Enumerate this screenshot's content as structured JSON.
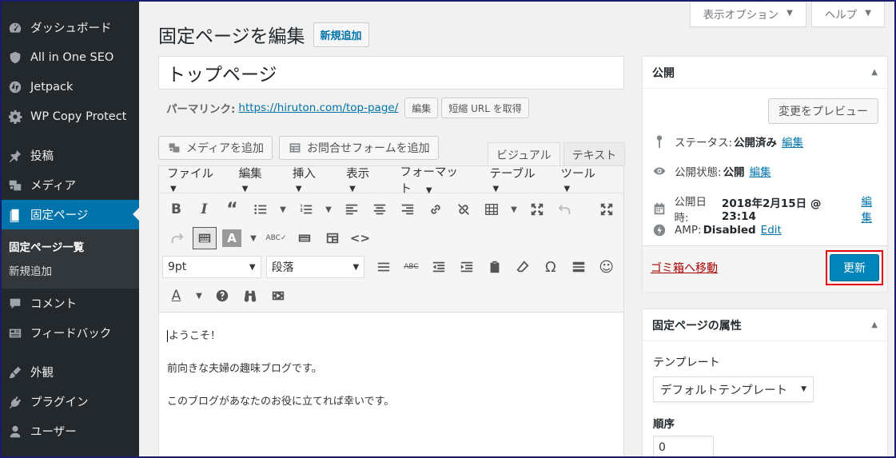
{
  "sidebar": {
    "items": [
      {
        "label": "ダッシュボード",
        "icon": "dashboard-icon"
      },
      {
        "label": "All in One SEO",
        "icon": "shield-icon"
      },
      {
        "label": "Jetpack",
        "icon": "jetpack-icon"
      },
      {
        "label": "WP Copy Protect",
        "icon": "gear-icon"
      },
      {
        "label": "投稿",
        "icon": "pin-icon"
      },
      {
        "label": "メディア",
        "icon": "media-icon"
      },
      {
        "label": "固定ページ",
        "icon": "page-icon"
      },
      {
        "label": "コメント",
        "icon": "comment-icon"
      },
      {
        "label": "フィードバック",
        "icon": "feedback-icon"
      },
      {
        "label": "外観",
        "icon": "appearance-icon"
      },
      {
        "label": "プラグイン",
        "icon": "plugin-icon"
      },
      {
        "label": "ユーザー",
        "icon": "user-icon"
      }
    ],
    "submenu": [
      {
        "label": "固定ページ一覧"
      },
      {
        "label": "新規追加"
      }
    ]
  },
  "header": {
    "screen_options": "表示オプション",
    "help": "ヘルプ",
    "title": "固定ページを編集",
    "add_new": "新規追加"
  },
  "post": {
    "title": "トップページ",
    "permalink_label": "パーマリンク:",
    "permalink_url": "https://hiruton.com/top-page/",
    "edit_btn": "編集",
    "shortlink_btn": "短縮 URL を取得"
  },
  "editor": {
    "add_media": "メディアを追加",
    "add_form": "お問合せフォームを追加",
    "tab_visual": "ビジュアル",
    "tab_text": "テキスト",
    "menu": [
      "ファイル",
      "編集",
      "挿入",
      "表示",
      "フォーマット",
      "テーブル",
      "ツール"
    ],
    "font_size": "9pt",
    "format": "段落",
    "content": [
      "ようこそ！",
      "前向きな夫婦の趣味ブログです。",
      "このブログがあなたのお役に立てれば幸いです。"
    ]
  },
  "publish": {
    "heading": "公開",
    "preview": "変更をプレビュー",
    "status_label": "ステータス:",
    "status_value": "公開済み",
    "visibility_label": "公開状態:",
    "visibility_value": "公開",
    "date_label": "公開日時:",
    "date_value": "2018年2月15日 @ 23:14",
    "amp_label": "AMP:",
    "amp_value": "Disabled",
    "edit": "編集",
    "amp_edit": "Edit",
    "trash": "ゴミ箱へ移動",
    "update": "更新"
  },
  "attributes": {
    "heading": "固定ページの属性",
    "template_label": "テンプレート",
    "template_value": "デフォルトテンプレート",
    "order_label": "順序",
    "order_value": "0"
  },
  "colors": {
    "sidebar_bg": "#23282d",
    "accent": "#0073aa",
    "update_btn": "#0085ba",
    "highlight": "#e60012",
    "trash": "#a00"
  }
}
